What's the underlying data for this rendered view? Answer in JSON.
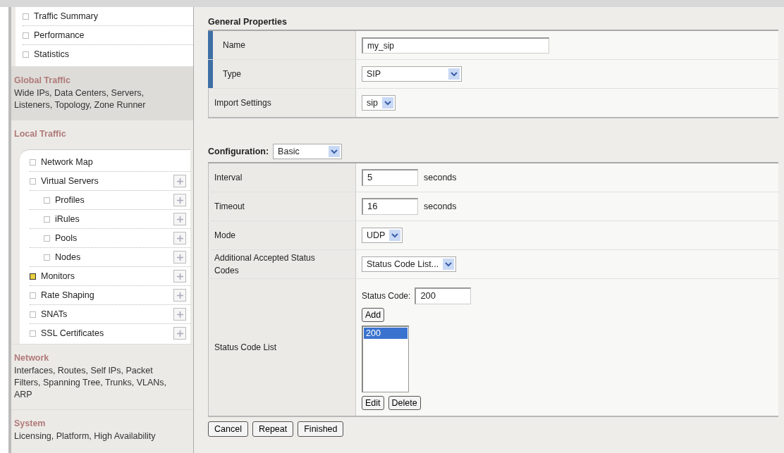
{
  "sidebar": {
    "top_items": [
      {
        "label": "Traffic Summary",
        "selected": false
      },
      {
        "label": "Performance",
        "selected": false
      },
      {
        "label": "Statistics",
        "selected": false
      }
    ],
    "sections": [
      {
        "title": "Global Traffic",
        "description": "Wide IPs, Data Centers, Servers, Listeners, Topology, Zone Runner"
      },
      {
        "title": "Local Traffic",
        "items": [
          {
            "label": "Network Map",
            "selected": false,
            "has_add": false
          },
          {
            "label": "Virtual Servers",
            "selected": false,
            "has_add": true,
            "children": [
              {
                "label": "Profiles",
                "selected": false,
                "has_add": true
              },
              {
                "label": "iRules",
                "selected": false,
                "has_add": true
              },
              {
                "label": "Pools",
                "selected": false,
                "has_add": true
              },
              {
                "label": "Nodes",
                "selected": false,
                "has_add": true
              }
            ]
          },
          {
            "label": "Monitors",
            "selected": true,
            "has_add": true
          },
          {
            "label": "Rate Shaping",
            "selected": false,
            "has_add": true
          },
          {
            "label": "SNATs",
            "selected": false,
            "has_add": true
          },
          {
            "label": "SSL Certificates",
            "selected": false,
            "has_add": true
          }
        ]
      },
      {
        "title": "Network",
        "description": "Interfaces, Routes, Self IPs, Packet Filters, Spanning Tree, Trunks, VLANs, ARP"
      },
      {
        "title": "System",
        "description": "Licensing, Platform, High Availability"
      }
    ]
  },
  "general": {
    "title": "General Properties",
    "rows": [
      {
        "label": "Name",
        "required": true,
        "control": {
          "kind": "text",
          "value": "my_sip"
        }
      },
      {
        "label": "Type",
        "required": true,
        "control": {
          "kind": "select",
          "value": "SIP"
        }
      },
      {
        "label": "Import Settings",
        "required": false,
        "control": {
          "kind": "select",
          "value": "sip"
        }
      }
    ]
  },
  "configuration": {
    "label": "Configuration:",
    "mode": {
      "value": "Basic"
    },
    "rows": [
      {
        "label": "Interval",
        "required": false,
        "control": {
          "kind": "number",
          "value": "5",
          "unit": "seconds"
        }
      },
      {
        "label": "Timeout",
        "required": false,
        "control": {
          "kind": "number",
          "value": "16",
          "unit": "seconds"
        }
      },
      {
        "label": "Mode",
        "required": false,
        "control": {
          "kind": "select",
          "value": "UDP"
        }
      },
      {
        "label": "Additional Accepted Status Codes",
        "required": false,
        "control": {
          "kind": "select",
          "value": "Status Code List..."
        }
      },
      {
        "label": "Status Code List",
        "required": false,
        "control": {
          "kind": "code_list",
          "field_label": "Status Code:",
          "value": "200",
          "add_button": "Add",
          "options": [
            {
              "label": "200",
              "selected": true
            }
          ],
          "buttons": [
            "Edit",
            "Delete"
          ]
        }
      }
    ]
  },
  "buttons": [
    "Cancel",
    "Repeat",
    "Finished"
  ]
}
